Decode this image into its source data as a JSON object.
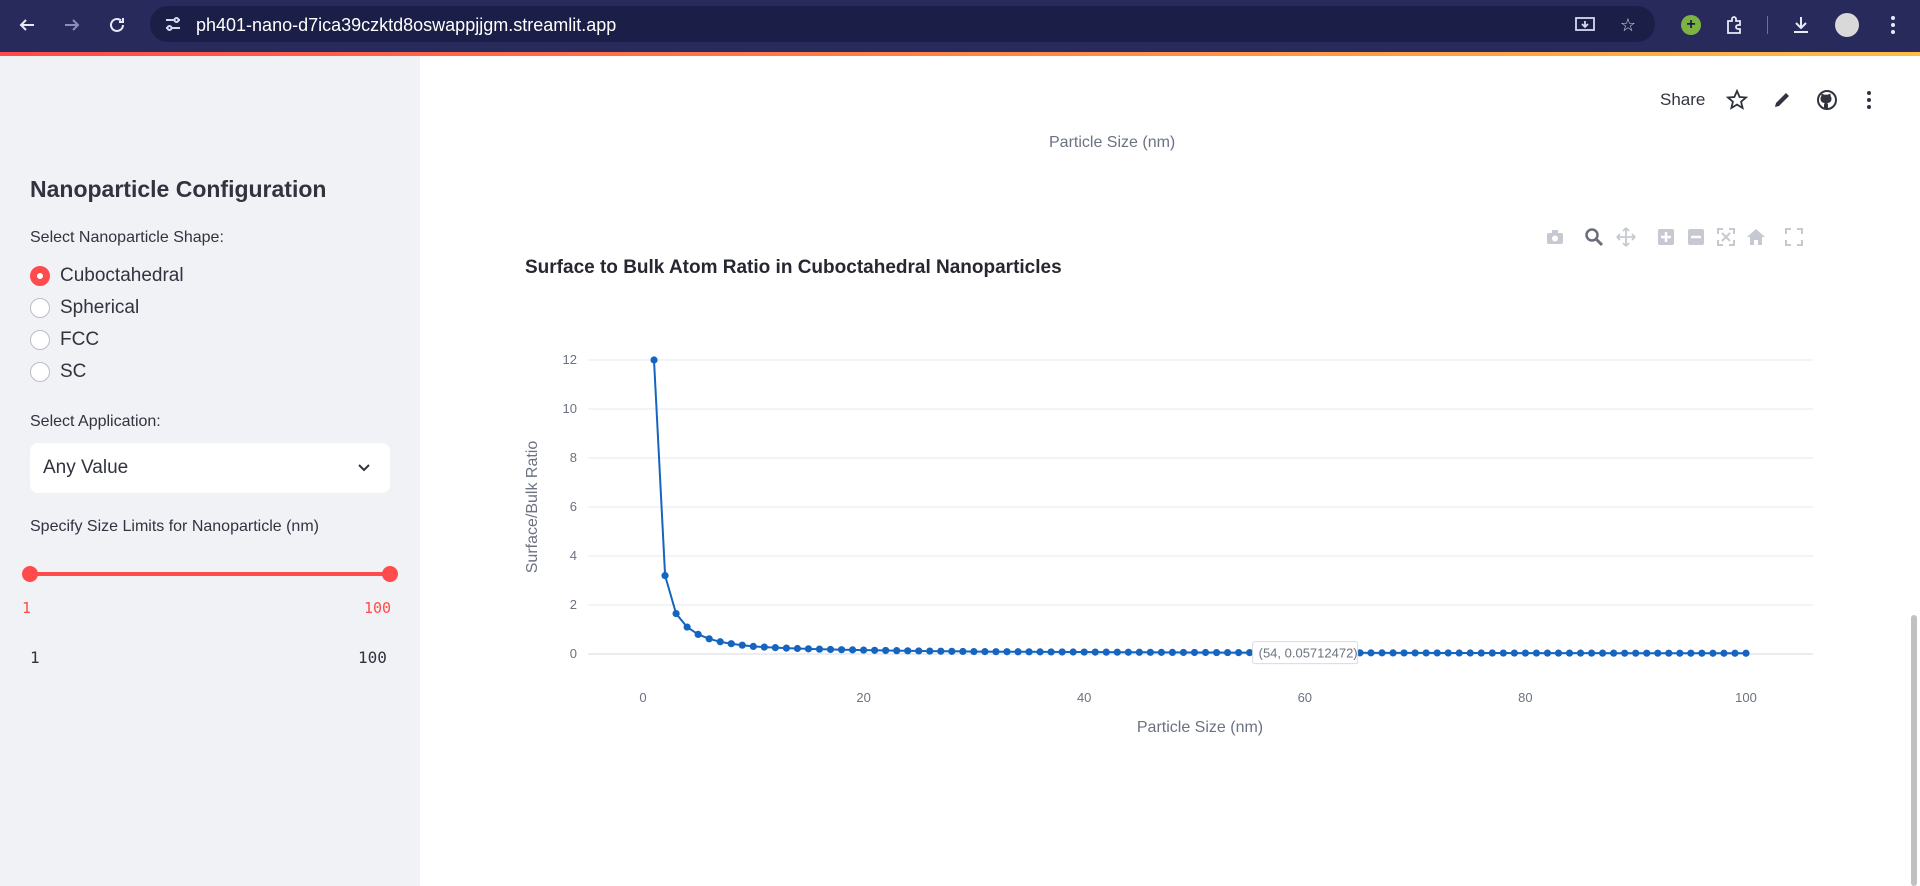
{
  "browser": {
    "url": "ph401-nano-d7ica39czktd8oswappjjgm.streamlit.app",
    "icons": [
      "back-arrow-icon",
      "forward-arrow-icon",
      "reload-icon",
      "site-settings-icon",
      "install-app-icon",
      "bookmark-star-icon",
      "extension-icon",
      "puzzle-icon",
      "download-icon",
      "profile-avatar",
      "kebab-menu-icon"
    ]
  },
  "sidebar": {
    "title": "Nanoparticle Configuration",
    "shape_label": "Select Nanoparticle Shape:",
    "shapes": [
      {
        "label": "Cuboctahedral",
        "checked": true
      },
      {
        "label": "Spherical",
        "checked": false
      },
      {
        "label": "FCC",
        "checked": false
      },
      {
        "label": "SC",
        "checked": false
      }
    ],
    "application_label": "Select Application:",
    "application_value": "Any Value",
    "size_label": "Specify Size Limits for Nanoparticle (nm)",
    "size_min_value": "1",
    "size_max_value": "100",
    "size_range_min": "1",
    "size_range_max": "100",
    "accent_color": "#ff4b4b"
  },
  "header": {
    "share_label": "Share"
  },
  "previous_chart": {
    "xlabel": "Particle Size (nm)"
  },
  "chart_data": {
    "type": "line",
    "title": "Surface to Bulk Atom Ratio in Cuboctahedral Nanoparticles",
    "xlabel": "Particle Size (nm)",
    "ylabel": "Surface/Bulk Ratio",
    "xlim": [
      -10,
      106
    ],
    "ylim": [
      0,
      12
    ],
    "x_ticks": [
      0,
      20,
      40,
      60,
      80,
      100
    ],
    "y_ticks": [
      0,
      2,
      4,
      6,
      8,
      10,
      12
    ],
    "grid": true,
    "line_color": "#1565c0",
    "series": [
      {
        "x_start": 1,
        "x_end": 100,
        "x_step": 1,
        "sample_points": [
          [
            1,
            12
          ],
          [
            2,
            3.2
          ],
          [
            3,
            1.65
          ],
          [
            4,
            1.1
          ],
          [
            5,
            0.8
          ],
          [
            6,
            0.62
          ],
          [
            7,
            0.5
          ],
          [
            8,
            0.42
          ],
          [
            9,
            0.36
          ],
          [
            10,
            0.31
          ],
          [
            20,
            0.16
          ],
          [
            30,
            0.1
          ],
          [
            40,
            0.08
          ],
          [
            54,
            0.05712472
          ],
          [
            100,
            0.03
          ]
        ]
      }
    ],
    "hover_label": "(54, 0.05712472)"
  }
}
